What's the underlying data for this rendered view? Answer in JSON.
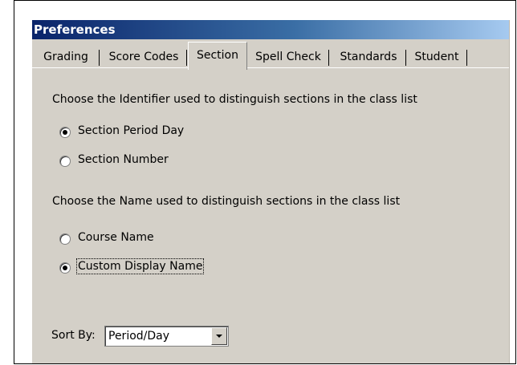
{
  "window": {
    "title": "Preferences"
  },
  "tabs": [
    {
      "label": "Grading"
    },
    {
      "label": "Score Codes"
    },
    {
      "label": "Section",
      "active": true
    },
    {
      "label": "Spell Check"
    },
    {
      "label": "Standards"
    },
    {
      "label": "Student"
    }
  ],
  "section": {
    "identifier_prompt": "Choose the Identifier used to distinguish sections in the class list",
    "identifier_options": [
      {
        "label": "Section Period Day",
        "checked": true
      },
      {
        "label": "Section Number",
        "checked": false
      }
    ],
    "name_prompt": "Choose the Name used to distinguish sections in the class list",
    "name_options": [
      {
        "label": "Course Name",
        "checked": false
      },
      {
        "label": "Custom Display Name",
        "checked": true
      }
    ],
    "sort_by_label": "Sort By:",
    "sort_by_value": "Period/Day"
  }
}
